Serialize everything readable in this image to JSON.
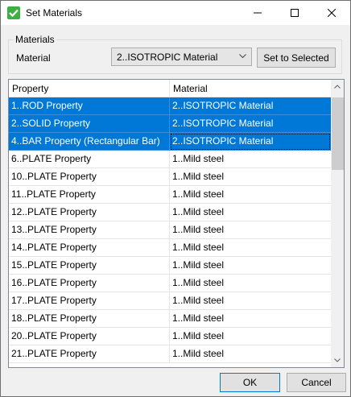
{
  "window": {
    "title": "Set Materials",
    "icon": "check-icon",
    "controls": [
      "minimize-icon",
      "maximize-icon",
      "close-icon"
    ]
  },
  "materials_group": {
    "label": "Materials",
    "material_label": "Material",
    "combo_value": "2..ISOTROPIC Material",
    "set_button": "Set to Selected"
  },
  "grid": {
    "columns": [
      "Property",
      "Material"
    ],
    "rows": [
      {
        "property": "1..ROD Property",
        "material": "2..ISOTROPIC Material",
        "selected": true
      },
      {
        "property": "2..SOLID Property",
        "material": "2..ISOTROPIC Material",
        "selected": true
      },
      {
        "property": "4..BAR Property (Rectangular Bar)",
        "material": "2..ISOTROPIC Material",
        "selected": true,
        "focused": true
      },
      {
        "property": "6..PLATE Property",
        "material": "1..Mild steel"
      },
      {
        "property": "10..PLATE Property",
        "material": "1..Mild steel"
      },
      {
        "property": "11..PLATE Property",
        "material": "1..Mild steel"
      },
      {
        "property": "12..PLATE Property",
        "material": "1..Mild steel"
      },
      {
        "property": "13..PLATE Property",
        "material": "1..Mild steel"
      },
      {
        "property": "14..PLATE Property",
        "material": "1..Mild steel"
      },
      {
        "property": "15..PLATE Property",
        "material": "1..Mild steel"
      },
      {
        "property": "16..PLATE Property",
        "material": "1..Mild steel"
      },
      {
        "property": "17..PLATE Property",
        "material": "1..Mild steel"
      },
      {
        "property": "18..PLATE Property",
        "material": "1..Mild steel"
      },
      {
        "property": "20..PLATE Property",
        "material": "1..Mild steel"
      },
      {
        "property": "21..PLATE Property",
        "material": "1..Mild steel"
      }
    ]
  },
  "footer": {
    "ok": "OK",
    "cancel": "Cancel"
  },
  "colors": {
    "selection": "#0078d7",
    "accent_green": "#3cb043"
  }
}
